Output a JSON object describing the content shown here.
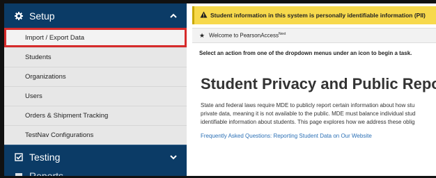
{
  "sidebar": {
    "setup": {
      "label": "Setup",
      "icon": "gear-icon",
      "items": [
        {
          "label": "Import / Export Data"
        },
        {
          "label": "Students"
        },
        {
          "label": "Organizations"
        },
        {
          "label": "Users"
        },
        {
          "label": "Orders & Shipment Tracking"
        },
        {
          "label": "TestNav Configurations"
        }
      ]
    },
    "testing": {
      "label": "Testing",
      "icon": "checkbox-icon"
    },
    "reports": {
      "label": "Reports"
    }
  },
  "main": {
    "alert": "Student information in this system is personally identifiable information (PII)",
    "welcome_prefix": "Welcome to PearsonAccess",
    "welcome_sup": "Next",
    "instruction": "Select an action from one of the dropdown menus under an icon to begin a task.",
    "heading": "Student Privacy and Public Reports",
    "body_lines": [
      "State and federal laws require MDE to publicly report certain information about how stu",
      "private data, meaning it is not available to the public. MDE must balance individual stud",
      "identifiable information about students. This page explores how we address these oblig"
    ],
    "faq_link": "Frequently Asked Questions: Reporting Student Data on Our Website"
  },
  "colors": {
    "sidebar_bg": "#0b3b66",
    "alert_bg": "#f7d94c",
    "active_border": "#d62b2b",
    "link": "#2a6fb5"
  }
}
